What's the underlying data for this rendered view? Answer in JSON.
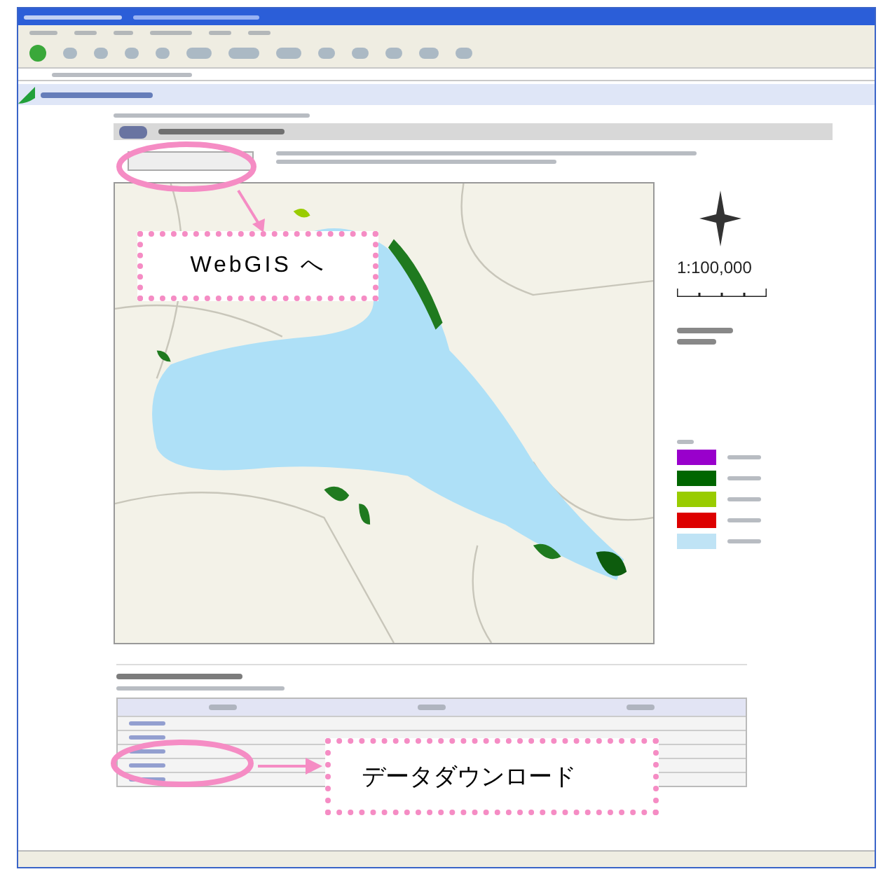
{
  "map": {
    "scale": "1:100,000",
    "legend": [
      {
        "color": "#9900cc"
      },
      {
        "color": "#006600"
      },
      {
        "color": "#99cc00"
      },
      {
        "color": "#dd0000"
      },
      {
        "color": "#bfe3f5"
      }
    ]
  },
  "callouts": [
    {
      "text": "WebGIS へ"
    },
    {
      "text": "データダウンロード"
    }
  ]
}
